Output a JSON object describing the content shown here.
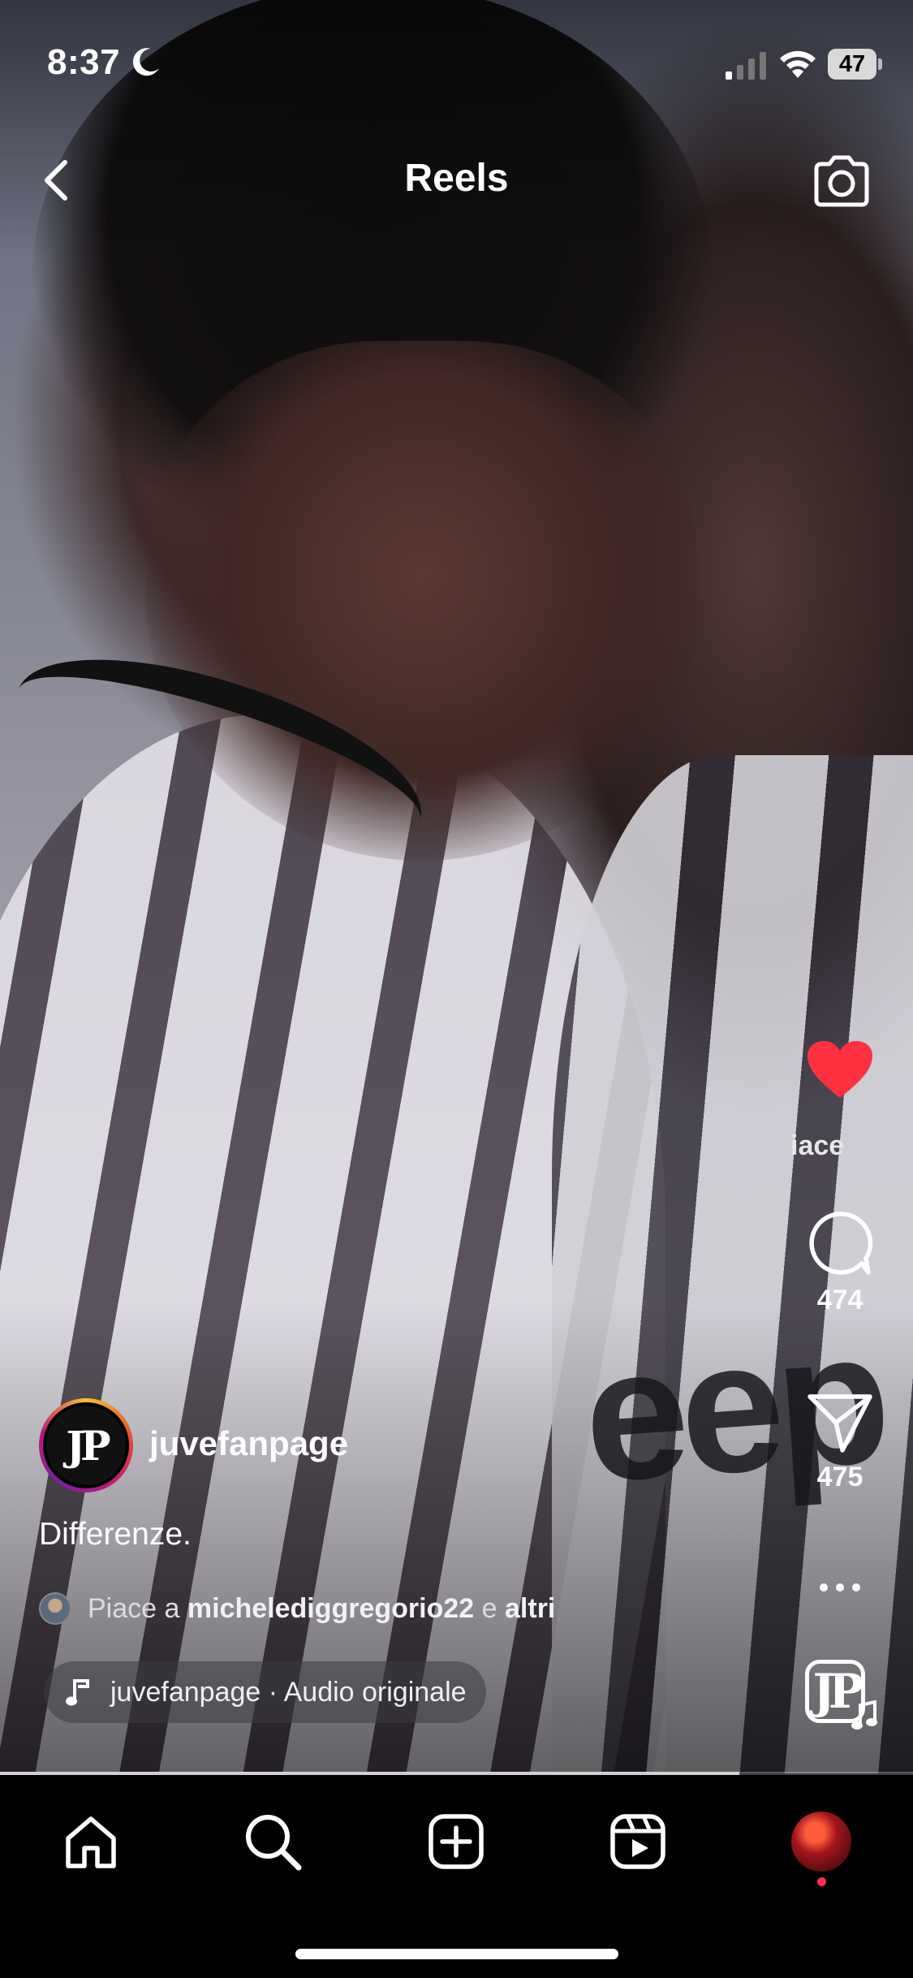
{
  "status_bar": {
    "time": "8:37",
    "battery": "47"
  },
  "header": {
    "title": "Reels"
  },
  "actions": {
    "like_label": "iace",
    "like_color": "#ff3040",
    "comments": "474",
    "shares": "475"
  },
  "reel": {
    "username": "juvefanpage",
    "caption": "Differenze.",
    "liked_by": {
      "prefix": "Piace a",
      "user": "michelediggregorio22",
      "connector": "e",
      "suffix": "altri"
    },
    "audio": "juvefanpage · Audio originale",
    "progress": 0.81
  },
  "background_text": "eep",
  "icons": {
    "back": "chevron-left-icon",
    "camera": "camera-icon",
    "like": "heart-icon",
    "comment": "comment-icon",
    "share": "send-icon",
    "more": "more-icon",
    "home": "home-icon",
    "search": "search-icon",
    "create": "create-icon",
    "reels": "reels-icon"
  }
}
